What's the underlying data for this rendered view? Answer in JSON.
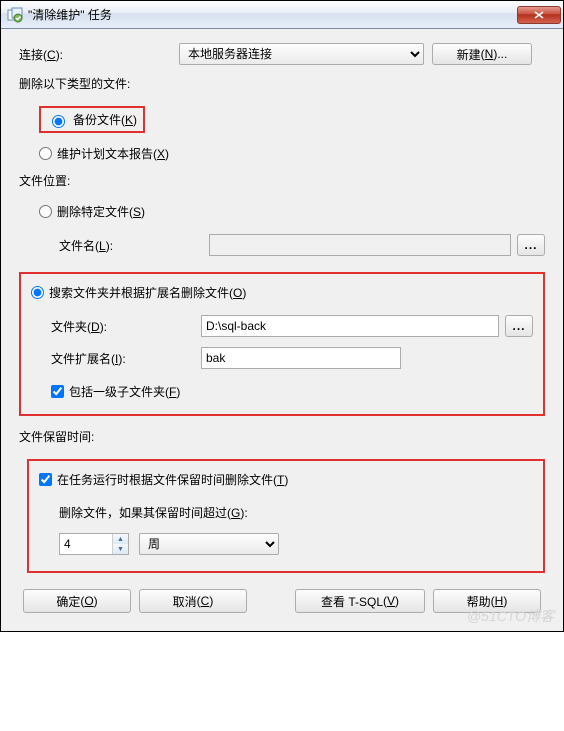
{
  "title": "\"清除维护\" 任务",
  "connection": {
    "label": "连接",
    "key": "C",
    "selected": "本地服务器连接",
    "new_btn": "新建",
    "new_key": "N",
    "ellipsis": "..."
  },
  "delete_types_label": "删除以下类型的文件:",
  "radio_backup": {
    "label": "备份文件",
    "key": "K"
  },
  "radio_report": {
    "label": "维护计划文本报告",
    "key": "X"
  },
  "location_label": "文件位置:",
  "radio_specific": {
    "label": "删除特定文件",
    "key": "S"
  },
  "filename": {
    "label": "文件名",
    "key": "L",
    "value": ""
  },
  "radio_search": {
    "label": "搜索文件夹并根据扩展名删除文件",
    "key": "O"
  },
  "folder": {
    "label": "文件夹",
    "key": "D",
    "value": "D:\\sql-back"
  },
  "extension": {
    "label": "文件扩展名",
    "key": "I",
    "value": "bak"
  },
  "include_sub": {
    "label": "包括一级子文件夹",
    "key": "F"
  },
  "retention_label": "文件保留时间:",
  "delete_by_age": {
    "label": "在任务运行时根据文件保留时间删除文件",
    "key": "T"
  },
  "delete_older": {
    "label": "删除文件，如果其保留时间超过",
    "key": "G"
  },
  "age_value": "4",
  "age_unit": "周",
  "buttons": {
    "ok": "确定",
    "ok_key": "O",
    "cancel": "取消",
    "cancel_key": "C",
    "tsql": "查看 T-SQL",
    "tsql_key": "V",
    "help": "帮助",
    "help_key": "H"
  },
  "watermark": "@51CTO博客"
}
